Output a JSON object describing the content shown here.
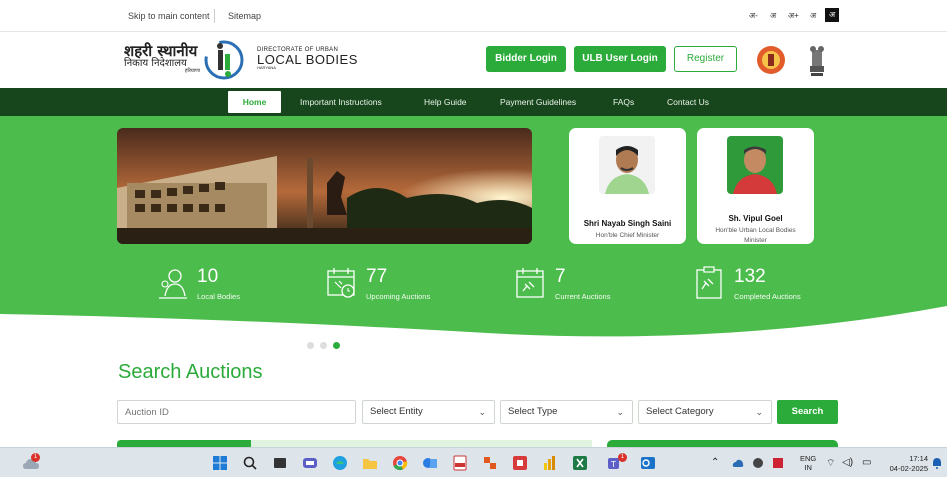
{
  "topbar": {
    "skip_link": "Skip to main content",
    "sitemap_link": "Sitemap",
    "font_controls": [
      "अ-",
      "अ",
      "अ+",
      "अ"
    ],
    "contrast_label": "अ"
  },
  "header": {
    "logo_hindi_line1": "शहरी स्थानीय",
    "logo_hindi_line2": "निकाय निदेशालय",
    "logo_hindi_line3": "हरियाणा",
    "logo_eng_line1": "DIRECTORATE OF URBAN",
    "logo_eng_line2": "LOCAL BODIES",
    "logo_eng_line3": "HARYANA",
    "bidder_login": "Bidder Login",
    "ulb_login": "ULB User Login",
    "register": "Register"
  },
  "nav": {
    "items": [
      "Home",
      "Important Instructions",
      "Help Guide",
      "Payment Guidelines",
      "FAQs",
      "Contact Us"
    ],
    "active": "Home"
  },
  "hero": {
    "leaders": [
      {
        "name": "Shri Nayab Singh Saini",
        "role": "Hon'ble Chief Minister"
      },
      {
        "name": "Sh. Vipul Goel",
        "role": "Hon'ble Urban Local Bodies Minister"
      }
    ],
    "stats": [
      {
        "value": "10",
        "label": "Local Bodies",
        "icon": "people-icon"
      },
      {
        "value": "77",
        "label": "Upcoming Auctions",
        "icon": "calendar-clock-icon"
      },
      {
        "value": "7",
        "label": "Current Auctions",
        "icon": "calendar-gavel-icon"
      },
      {
        "value": "132",
        "label": "Completed Auctions",
        "icon": "clipboard-gavel-icon"
      }
    ]
  },
  "search": {
    "title": "Search Auctions",
    "auction_id_placeholder": "Auction ID",
    "entity_select": "Select Entity",
    "type_select": "Select Type",
    "category_select": "Select Category",
    "button": "Search"
  },
  "taskbar": {
    "lang_line1": "ENG",
    "lang_line2": "IN",
    "time": "17:14",
    "date": "04-02-2025",
    "weather_badge": "1",
    "teams_badge": "1"
  },
  "colors": {
    "brand_green": "#2bab3a",
    "nav_dark_green": "#17461c",
    "hero_green": "#4cbc4c"
  }
}
